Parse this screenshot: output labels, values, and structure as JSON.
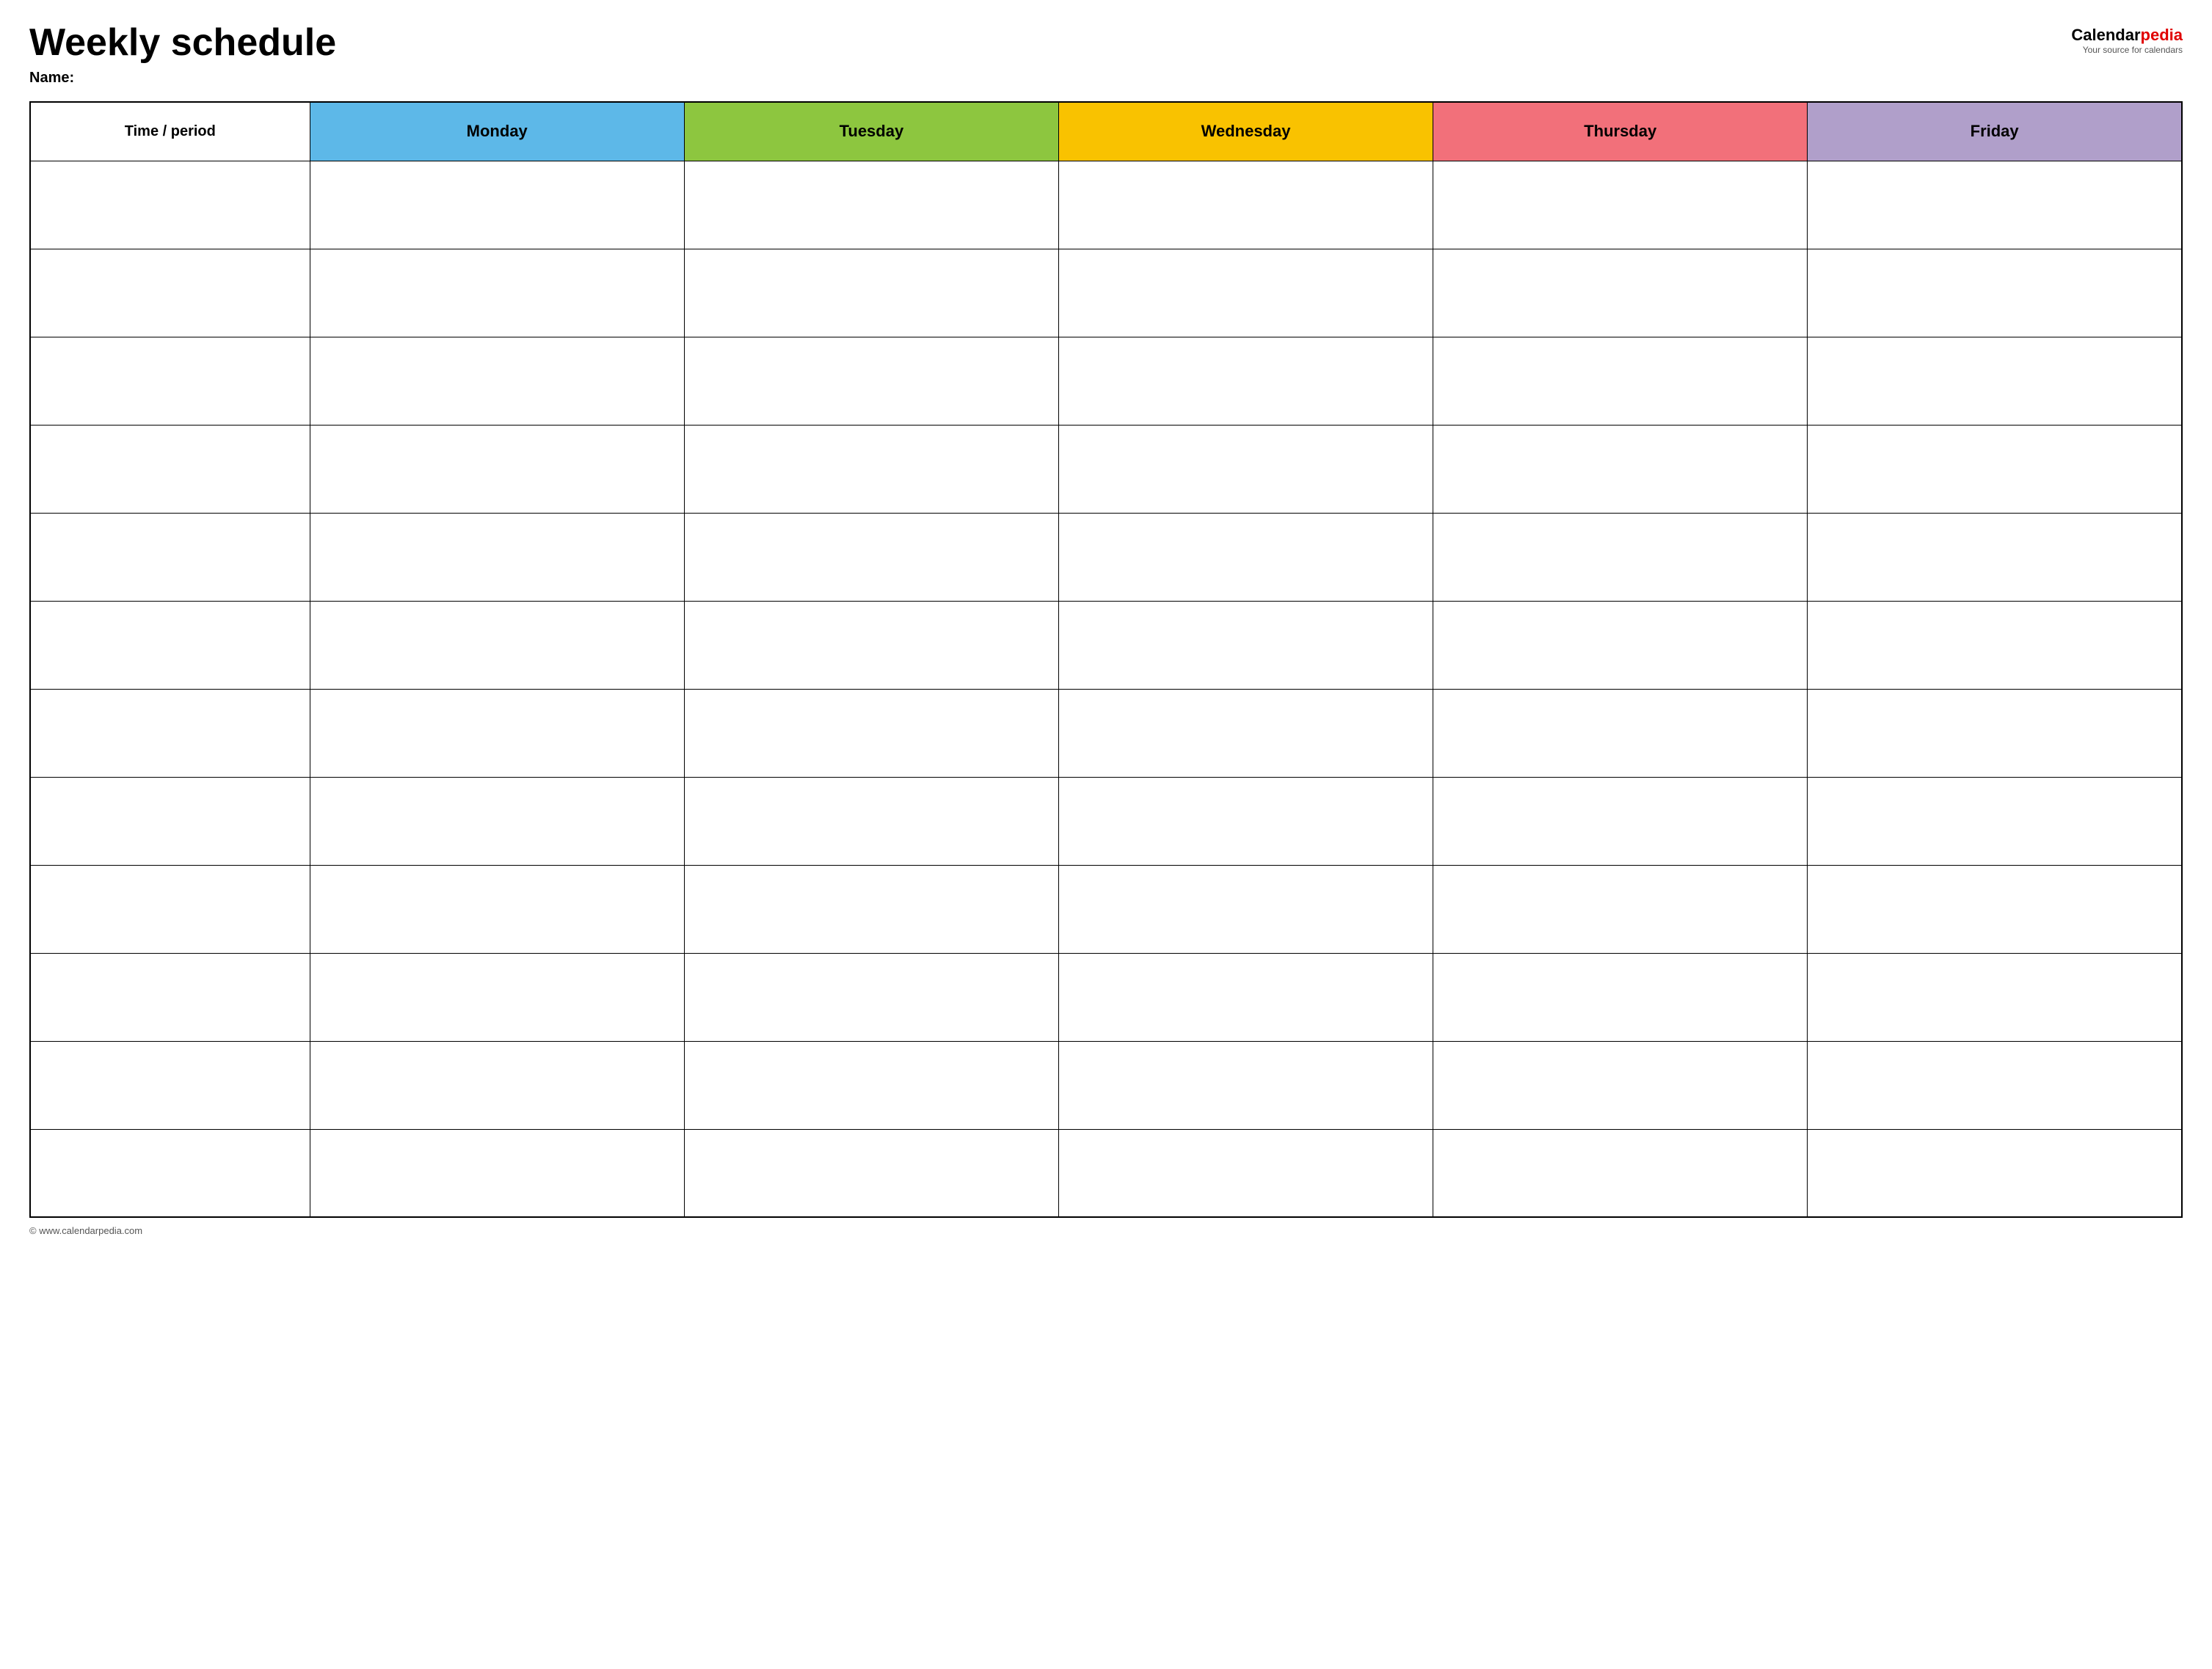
{
  "header": {
    "title": "Weekly schedule",
    "name_label": "Name:",
    "logo_calendar": "Calendar",
    "logo_pedia": "pedia",
    "logo_tagline": "Your source for calendars"
  },
  "table": {
    "columns": [
      {
        "id": "time",
        "label": "Time / period",
        "class": "time-header"
      },
      {
        "id": "monday",
        "label": "Monday",
        "class": "monday"
      },
      {
        "id": "tuesday",
        "label": "Tuesday",
        "class": "tuesday"
      },
      {
        "id": "wednesday",
        "label": "Wednesday",
        "class": "wednesday"
      },
      {
        "id": "thursday",
        "label": "Thursday",
        "class": "thursday"
      },
      {
        "id": "friday",
        "label": "Friday",
        "class": "friday"
      }
    ],
    "row_count": 12
  },
  "footer": {
    "url": "© www.calendarpedia.com"
  }
}
